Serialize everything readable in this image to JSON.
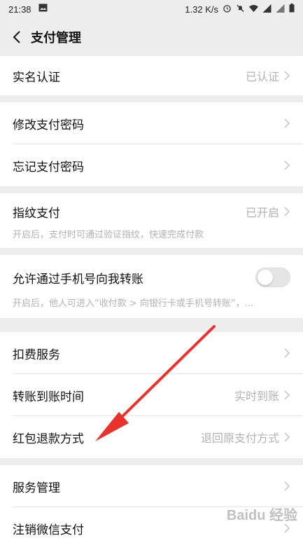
{
  "status_bar": {
    "time": "21:38",
    "network_speed": "1.32 K/s",
    "icons": [
      "image-icon",
      "alarm-icon",
      "mute-icon",
      "wifi-icon",
      "signal-icon",
      "signal-icon",
      "battery-icon"
    ]
  },
  "header": {
    "title": "支付管理",
    "back_icon": "chevron-left-icon"
  },
  "groups": [
    {
      "rows": [
        {
          "label": "实名认证",
          "value": "已认证"
        }
      ]
    },
    {
      "rows": [
        {
          "label": "修改支付密码"
        },
        {
          "label": "忘记支付密码"
        }
      ]
    },
    {
      "rows": [
        {
          "label": "指纹支付",
          "value": "已开启",
          "description": "开启后，支付时可通过验证指纹，快速完成付款"
        }
      ]
    },
    {
      "rows": [
        {
          "label": "允许通过手机号向我转账",
          "toggle": false,
          "description": "开启后，他人可进入“收付款 > 向银行卡或手机号转账”，..."
        }
      ]
    },
    {
      "rows": [
        {
          "label": "扣费服务"
        },
        {
          "label": "转账到账时间",
          "value": "实时到账"
        },
        {
          "label": "红包退款方式",
          "value": "退回原支付方式"
        }
      ]
    },
    {
      "rows": [
        {
          "label": "服务管理"
        },
        {
          "label": "注销微信支付"
        }
      ]
    }
  ],
  "watermark": {
    "text": "Baidu 经验"
  },
  "colors": {
    "background": "#ededed",
    "annotation_arrow": "#e8322d",
    "secondary_text": "#b2b2b2"
  }
}
